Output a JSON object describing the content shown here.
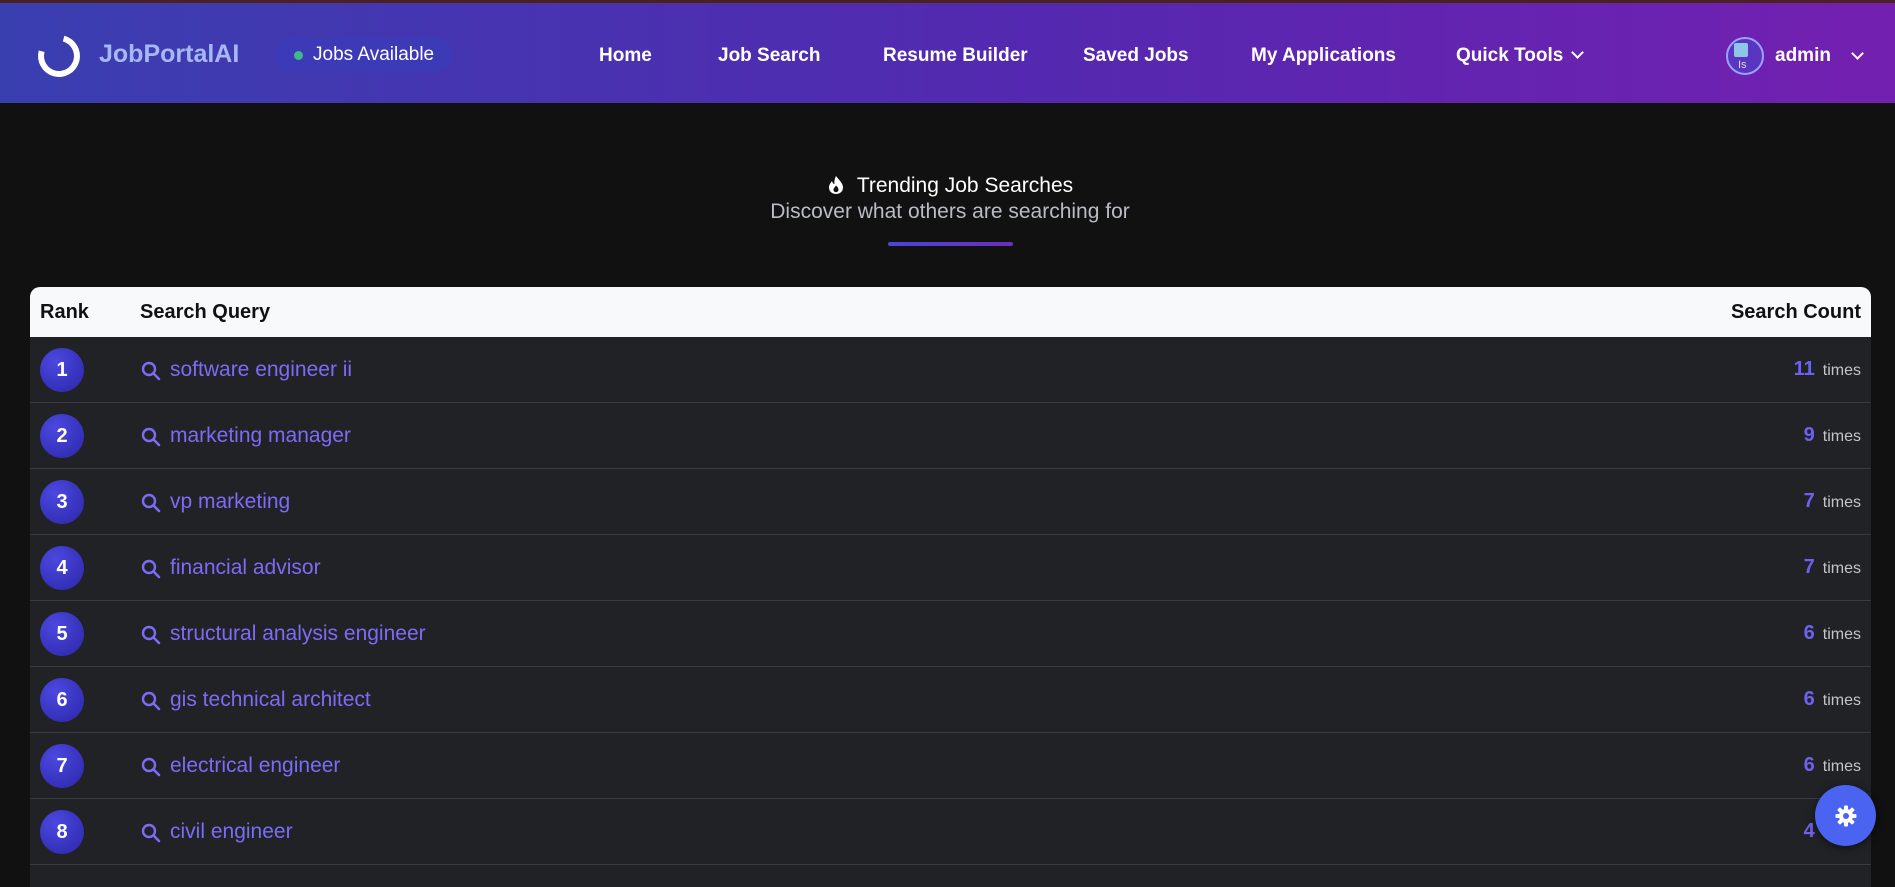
{
  "navbar": {
    "brand": "JobPortalAI",
    "jobs_pill": "Jobs Available",
    "links": [
      "Home",
      "Job Search",
      "Resume Builder",
      "Saved Jobs",
      "My Applications"
    ],
    "quick_tools": "Quick Tools",
    "avatar_alt": "Is",
    "user": "admin"
  },
  "heading": {
    "title": "Trending Job Searches",
    "subtitle": "Discover what others are searching for"
  },
  "table": {
    "headers": {
      "rank": "Rank",
      "query": "Search Query",
      "count": "Search Count"
    },
    "unit": "times",
    "rows": [
      {
        "rank": "1",
        "query": "software engineer ii",
        "count": "11"
      },
      {
        "rank": "2",
        "query": "marketing manager",
        "count": "9"
      },
      {
        "rank": "3",
        "query": "vp marketing",
        "count": "7"
      },
      {
        "rank": "4",
        "query": "financial advisor",
        "count": "7"
      },
      {
        "rank": "5",
        "query": "structural analysis engineer",
        "count": "6"
      },
      {
        "rank": "6",
        "query": "gis technical architect",
        "count": "6"
      },
      {
        "rank": "7",
        "query": "electrical engineer",
        "count": "6"
      },
      {
        "rank": "8",
        "query": "civil engineer",
        "count": "4"
      }
    ]
  },
  "colors": {
    "accent": "#6d62f0",
    "badge": "#3a36c8",
    "fab": "#4a63f0",
    "pill_dot": "#3fb98a"
  },
  "icons": {
    "logo": "logo-ring-icon",
    "fire": "fire-icon",
    "search": "search-icon",
    "chevron": "chevron-down-icon",
    "settings": "gear-icon"
  }
}
